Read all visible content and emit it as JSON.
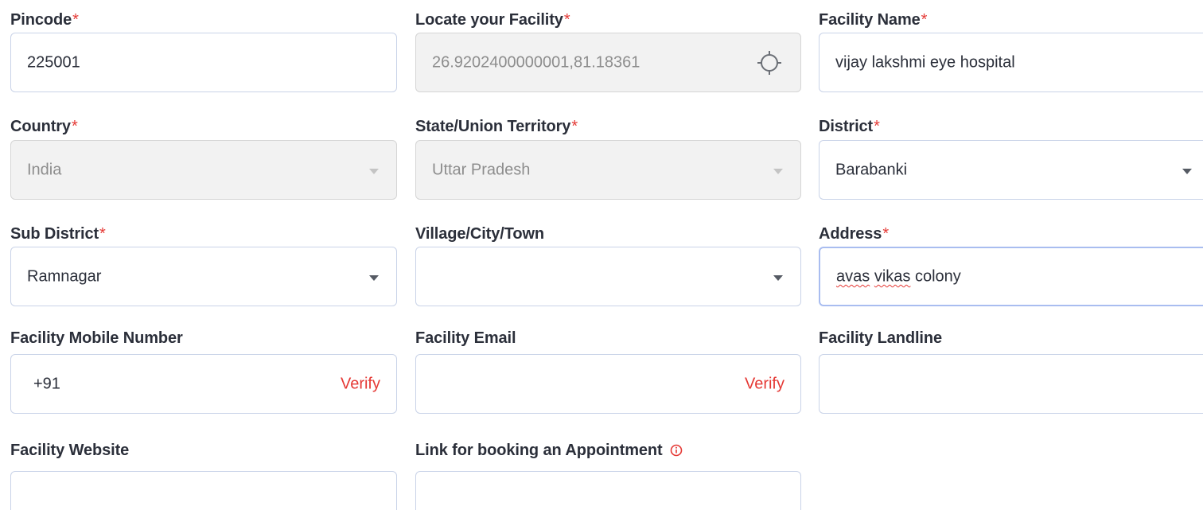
{
  "form": {
    "pincode": {
      "label": "Pincode",
      "value": "225001"
    },
    "locate": {
      "label": "Locate your Facility",
      "value": "26.9202400000001,81.18361"
    },
    "facility_name": {
      "label": "Facility Name",
      "value": "vijay lakshmi eye hospital"
    },
    "country": {
      "label": "Country",
      "value": "India"
    },
    "state": {
      "label": "State/Union Territory",
      "value": "Uttar Pradesh"
    },
    "district": {
      "label": "District",
      "value": "Barabanki"
    },
    "sub_district": {
      "label": "Sub District",
      "value": "Ramnagar"
    },
    "village": {
      "label": "Village/City/Town",
      "value": ""
    },
    "address": {
      "label": "Address",
      "value_word1": "avas",
      "value_word2": "vikas",
      "value_rest": "colony"
    },
    "mobile": {
      "label": "Facility Mobile Number",
      "prefix": "+91",
      "verify": "Verify"
    },
    "email": {
      "label": "Facility Email",
      "verify": "Verify"
    },
    "landline": {
      "label": "Facility Landline"
    },
    "website": {
      "label": "Facility Website"
    },
    "appointment": {
      "label": "Link for booking an Appointment"
    },
    "required_mark": "*"
  },
  "colors": {
    "required": "#e53935",
    "verify": "#e53935",
    "border": "#c9d3e8",
    "disabled_bg": "#f2f2f2"
  },
  "icons": {
    "locate": "crosshair-icon",
    "dropdown": "caret-down-icon",
    "info": "info-circle-icon"
  }
}
